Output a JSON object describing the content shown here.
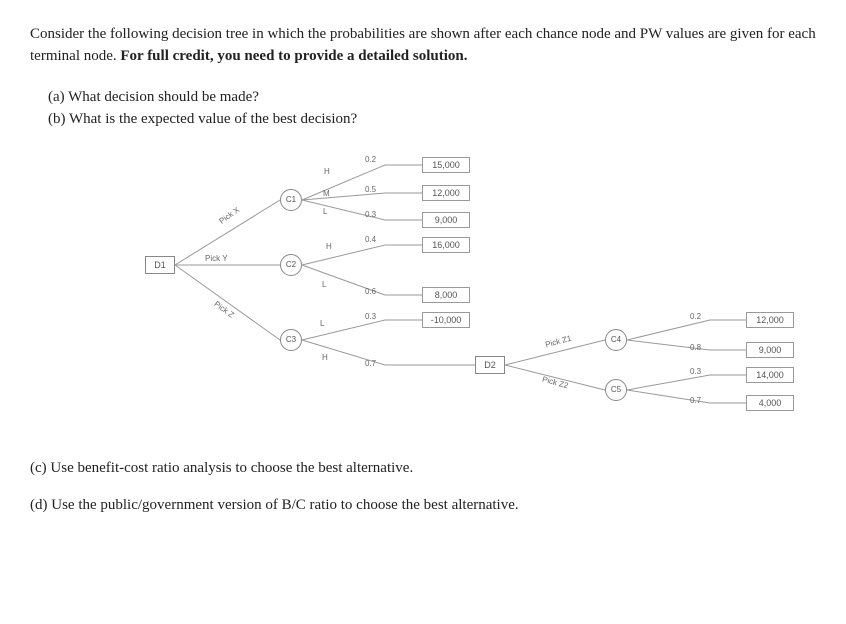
{
  "intro_prefix": "Consider the following decision tree in which the probabilities are shown after each chance node and PW values are given for each terminal node. ",
  "intro_bold": "For full credit, you need to provide a detailed solution.",
  "q_a": "(a) What decision should be made?",
  "q_b": "(b) What is the expected value of the best decision?",
  "q_c": "(c) Use benefit-cost ratio analysis to choose the best alternative.",
  "q_d": "(d) Use the public/government version of B/C ratio to choose the best alternative.",
  "nodes": {
    "D1": "D1",
    "D2": "D2",
    "C1": "C1",
    "C2": "C2",
    "C3": "C3",
    "C4": "C4",
    "C5": "C5"
  },
  "branch_labels": {
    "pick_x": "Pick X",
    "pick_y": "Pick Y",
    "pick_z": "Pick Z",
    "pick_z1": "Pick Z1",
    "pick_z2": "Pick Z2",
    "H": "H",
    "M": "M",
    "L": "L"
  },
  "probs": {
    "c1_h": "0.2",
    "c1_m": "0.5",
    "c1_l": "0.3",
    "c2_h": "0.4",
    "c2_l": "0.6",
    "c3_l": "0.3",
    "c3_h": "0.7",
    "c4_a": "0.2",
    "c4_b": "0.8",
    "c5_a": "0.3",
    "c5_b": "0.7"
  },
  "chart_data": {
    "type": "decision-tree",
    "root": {
      "kind": "decision",
      "name": "D1",
      "branches": [
        {
          "label": "Pick X",
          "to": {
            "kind": "chance",
            "name": "C1",
            "branches": [
              {
                "label": "H",
                "prob": 0.2,
                "to": {
                  "kind": "terminal",
                  "pw": 15000
                }
              },
              {
                "label": "M",
                "prob": 0.5,
                "to": {
                  "kind": "terminal",
                  "pw": 12000
                }
              },
              {
                "label": "L",
                "prob": 0.3,
                "to": {
                  "kind": "terminal",
                  "pw": 9000
                }
              }
            ]
          }
        },
        {
          "label": "Pick Y",
          "to": {
            "kind": "chance",
            "name": "C2",
            "branches": [
              {
                "label": "H",
                "prob": 0.4,
                "to": {
                  "kind": "terminal",
                  "pw": 16000
                }
              },
              {
                "label": "L",
                "prob": 0.6,
                "to": {
                  "kind": "terminal",
                  "pw": 8000
                }
              }
            ]
          }
        },
        {
          "label": "Pick Z",
          "to": {
            "kind": "chance",
            "name": "C3",
            "branches": [
              {
                "label": "L",
                "prob": 0.3,
                "to": {
                  "kind": "terminal",
                  "pw": -10000
                }
              },
              {
                "label": "H",
                "prob": 0.7,
                "to": {
                  "kind": "decision",
                  "name": "D2",
                  "branches": [
                    {
                      "label": "Pick Z1",
                      "to": {
                        "kind": "chance",
                        "name": "C4",
                        "branches": [
                          {
                            "prob": 0.2,
                            "to": {
                              "kind": "terminal",
                              "pw": 12000
                            }
                          },
                          {
                            "prob": 0.8,
                            "to": {
                              "kind": "terminal",
                              "pw": 9000
                            }
                          }
                        ]
                      }
                    },
                    {
                      "label": "Pick Z2",
                      "to": {
                        "kind": "chance",
                        "name": "C5",
                        "branches": [
                          {
                            "prob": 0.3,
                            "to": {
                              "kind": "terminal",
                              "pw": 14000
                            }
                          },
                          {
                            "prob": 0.7,
                            "to": {
                              "kind": "terminal",
                              "pw": 4000
                            }
                          }
                        ]
                      }
                    }
                  ]
                }
              }
            ]
          }
        }
      ]
    }
  },
  "terminals": {
    "t1": "15,000",
    "t2": "12,000",
    "t3": "9,000",
    "t4": "16,000",
    "t5": "8,000",
    "t6": "-10,000",
    "t7": "12,000",
    "t8": "9,000",
    "t9": "14,000",
    "t10": "4,000"
  }
}
